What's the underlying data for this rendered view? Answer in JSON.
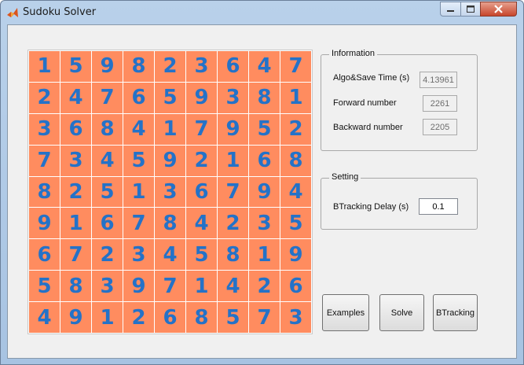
{
  "window": {
    "title": "Sudoku Solver"
  },
  "board": [
    [
      1,
      5,
      9,
      8,
      2,
      3,
      6,
      4,
      7
    ],
    [
      2,
      4,
      7,
      6,
      5,
      9,
      3,
      8,
      1
    ],
    [
      3,
      6,
      8,
      4,
      1,
      7,
      9,
      5,
      2
    ],
    [
      7,
      3,
      4,
      5,
      9,
      2,
      1,
      6,
      8
    ],
    [
      8,
      2,
      5,
      1,
      3,
      6,
      7,
      9,
      4
    ],
    [
      9,
      1,
      6,
      7,
      8,
      4,
      2,
      3,
      5
    ],
    [
      6,
      7,
      2,
      3,
      4,
      5,
      8,
      1,
      9
    ],
    [
      5,
      8,
      3,
      9,
      7,
      1,
      4,
      2,
      6
    ],
    [
      4,
      9,
      1,
      2,
      6,
      8,
      5,
      7,
      3
    ]
  ],
  "information": {
    "title": "Information",
    "algo_label": "Algo&Save Time (s)",
    "algo_value": "4.13961",
    "forward_label": "Forward number",
    "forward_value": "2261",
    "backward_label": "Backward number",
    "backward_value": "2205"
  },
  "setting": {
    "title": "Setting",
    "delay_label": "BTracking Delay (s)",
    "delay_value": "0.1"
  },
  "buttons": {
    "examples": "Examples",
    "solve": "Solve",
    "btracking": "BTracking"
  },
  "colors": {
    "cell_bg": "#ff8c5f",
    "cell_text": "#2472c8"
  }
}
